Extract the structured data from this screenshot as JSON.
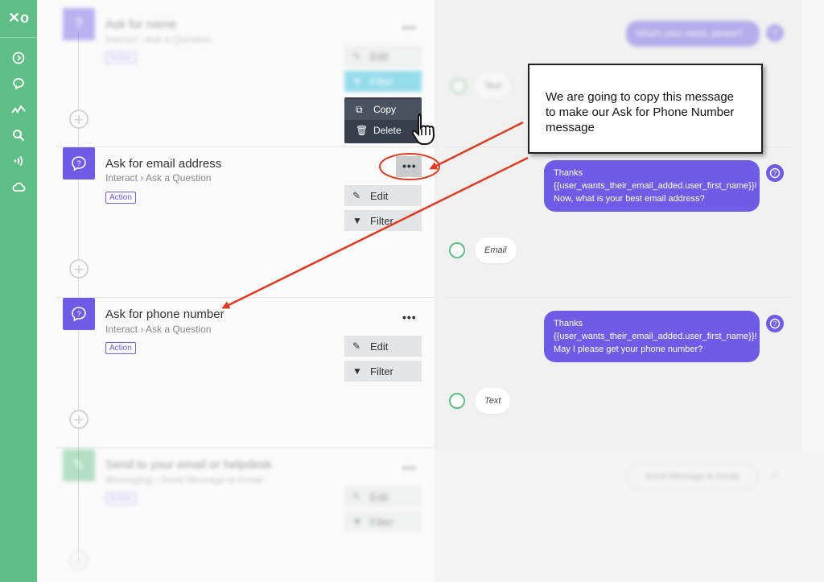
{
  "sidebar": {
    "logo": "✕o",
    "icons": [
      "chevron-right-circle-icon",
      "chat-bubble-icon",
      "activity-icon",
      "search-icon",
      "broadcast-icon",
      "cloud-icon"
    ]
  },
  "steps": [
    {
      "title": "Ask for name",
      "breadcrumb_1": "Interact",
      "breadcrumb_2": "Ask a Question",
      "badge": "Action",
      "more": "•••",
      "edit": "Edit",
      "filter": "Filter"
    },
    {
      "title": "Ask for email address",
      "breadcrumb_1": "Interact",
      "breadcrumb_2": "Ask a Question",
      "badge": "Action",
      "more": "•••",
      "edit": "Edit",
      "filter": "Filter"
    },
    {
      "title": "Ask for phone number",
      "breadcrumb_1": "Interact",
      "breadcrumb_2": "Ask a Question",
      "badge": "Action",
      "more": "•••",
      "edit": "Edit",
      "filter": "Filter"
    },
    {
      "title": "Send to your email or helpdesk",
      "breadcrumb_1": "Messaging",
      "breadcrumb_2": "Send Message to Email",
      "badge": "Action",
      "more": "•••",
      "edit": "Edit",
      "filter": "Filter"
    }
  ],
  "dropdown": {
    "copy": "Copy",
    "delete": "Delete"
  },
  "chat": {
    "top_bubble": "What's your name, please?",
    "top_response": "Text",
    "email_bubble": "Thanks {{user_wants_their_email_added.user_first_name}}! Now, what is your best email address?",
    "email_response": "Email",
    "phone_bubble": "Thanks {{user_wants_their_email_added.user_first_name}}! May I please get your phone number?",
    "phone_response": "Text",
    "send_email_label": "Send Message to Email",
    "qmark": "?"
  },
  "callout": {
    "text": "We are going to copy this message to make our Ask for Phone Number message"
  },
  "colors": {
    "sidebar": "#5fbe85",
    "accent": "#6e5ce6",
    "arrow": "#e03a22"
  }
}
